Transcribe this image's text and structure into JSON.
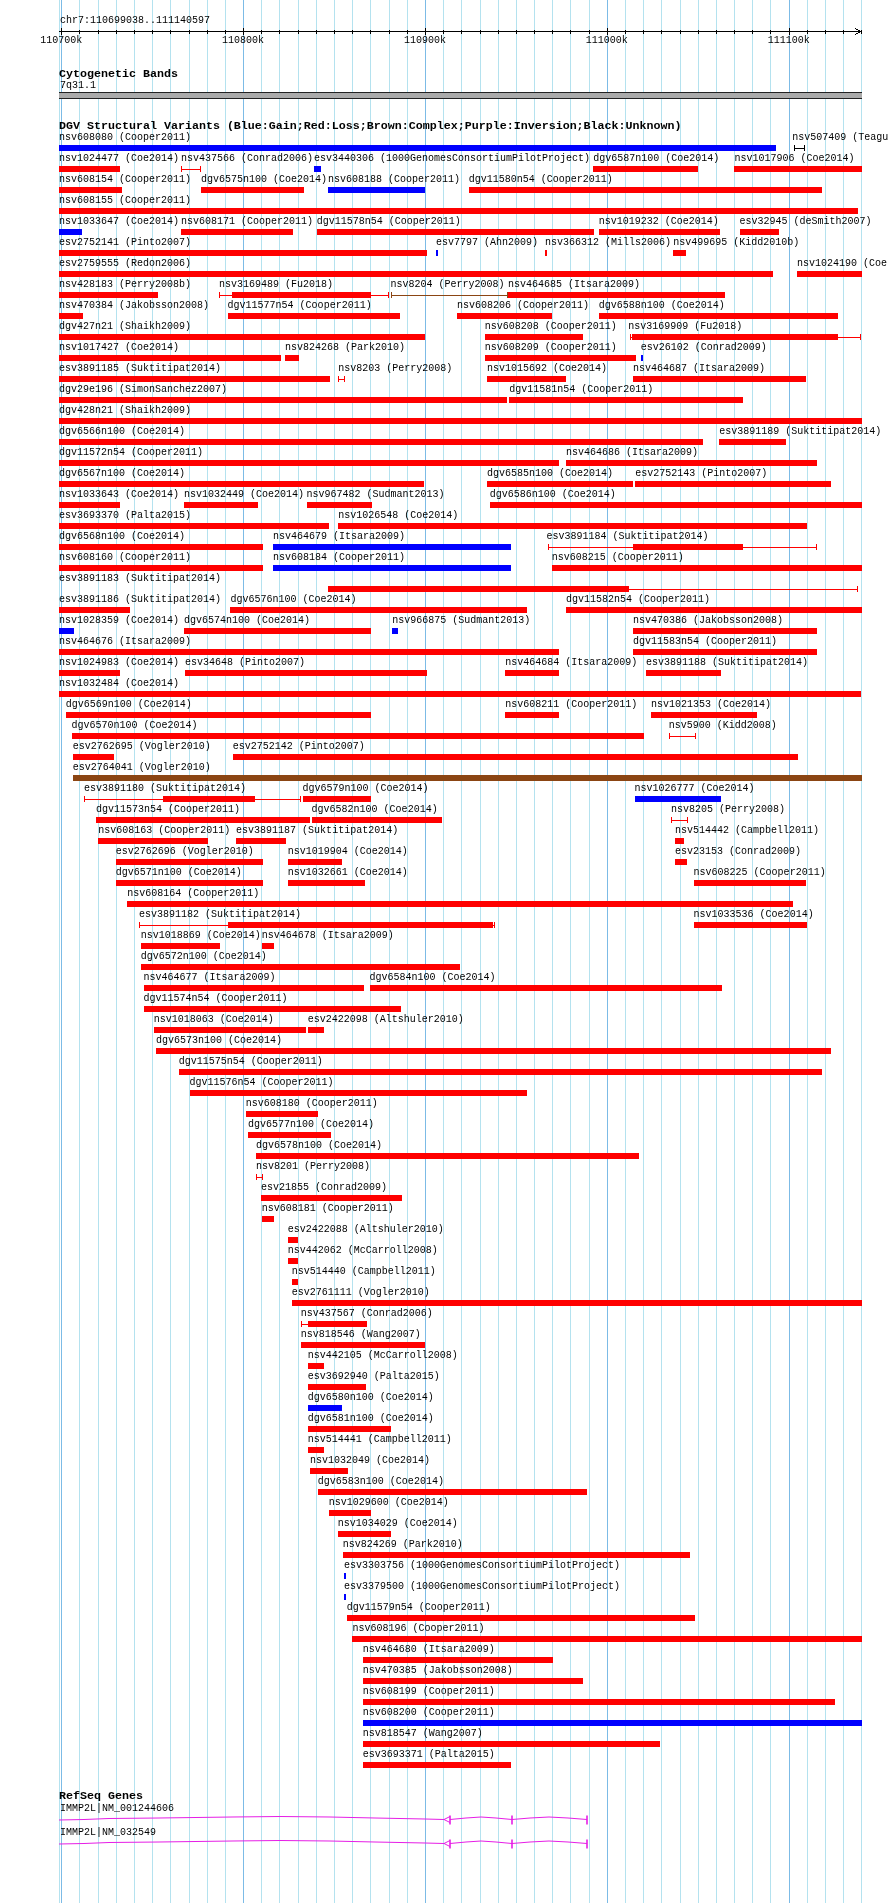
{
  "ruler": {
    "region": "chr7:110699038..111140597",
    "ticks": [
      "110700k",
      "110800k",
      "110900k",
      "111000k",
      "111100k"
    ]
  },
  "cytogenetic_bands": {
    "title": "Cytogenetic Bands",
    "band": "7q31.1"
  },
  "dgv_structural_variants": {
    "title": "DGV Structural Variants (Blue:Gain;Red:Loss;Brown:Complex;Purple:Inversion;Black:Unknown)",
    "rows": [
      {
        "features": [
          {
            "label": "nsv608080 (Cooper2011)",
            "color": "#0000ff"
          },
          {
            "label": "nsv507409 (Teagu",
            "color": "#000000"
          }
        ]
      },
      {
        "features": [
          {
            "label": "nsv1024477 (Coe2014)",
            "color": "#ff0000"
          },
          {
            "label": "nsv437566 (Conrad2006)",
            "color": "#ff0000"
          },
          {
            "label": "esv3440306 (1000GenomesConsortiumPilotProject)",
            "color": "#0000ff"
          },
          {
            "label": "dgv6587n100 (Coe2014)",
            "color": "#ff0000"
          },
          {
            "label": "nsv1017906 (Coe2014)",
            "color": "#ff0000"
          }
        ]
      },
      {
        "features": [
          {
            "label": "nsv608154 (Cooper2011)",
            "color": "#ff0000"
          },
          {
            "label": "dgv6575n100 (Coe2014)",
            "color": "#ff0000"
          },
          {
            "label": "nsv608188 (Cooper2011)",
            "color": "#0000ff"
          },
          {
            "label": "dgv11580n54 (Cooper2011)",
            "color": "#ff0000"
          }
        ]
      },
      {
        "features": [
          {
            "label": "nsv608155 (Cooper2011)",
            "color": "#ff0000"
          }
        ]
      },
      {
        "features": [
          {
            "label": "nsv1033647 (Coe2014)",
            "color": "#0000ff"
          },
          {
            "label": "nsv608171 (Cooper2011)",
            "color": "#ff0000"
          },
          {
            "label": "dgv11578n54 (Cooper2011)",
            "color": "#ff0000"
          },
          {
            "label": "nsv1019232 (Coe2014)",
            "color": "#ff0000"
          },
          {
            "label": "esv32945 (deSmith2007)",
            "color": "#ff0000"
          }
        ]
      },
      {
        "features": [
          {
            "label": "esv2752141 (Pinto2007)",
            "color": "#ff0000"
          },
          {
            "label": "esv7797 (Ahn2009)",
            "color": "#0000ff"
          },
          {
            "label": "nsv366312 (Mills2006)",
            "color": "#ff0000"
          },
          {
            "label": "nsv499695 (Kidd2010b)",
            "color": "#ff0000"
          }
        ]
      },
      {
        "features": [
          {
            "label": "esv2759555 (Redon2006)",
            "color": "#ff0000"
          },
          {
            "label": "nsv1024190 (Coe",
            "color": "#ff0000"
          }
        ]
      },
      {
        "features": [
          {
            "label": "nsv428183 (Perry2008b)",
            "color": "#ff0000"
          },
          {
            "label": "nsv3169489 (Fu2018)",
            "color": "#ff0000"
          },
          {
            "label": "nsv8204 (Perry2008)",
            "color": "#8b4513"
          },
          {
            "label": "nsv464685 (Itsara2009)",
            "color": "#ff0000"
          }
        ]
      },
      {
        "features": [
          {
            "label": "nsv470384 (Jakobsson2008)",
            "color": "#ff0000"
          },
          {
            "label": "dgv11577n54 (Cooper2011)",
            "color": "#ff0000"
          },
          {
            "label": "nsv608206 (Cooper2011)",
            "color": "#ff0000"
          },
          {
            "label": "dgv6588n100 (Coe2014)",
            "color": "#ff0000"
          }
        ]
      },
      {
        "features": [
          {
            "label": "dgv427n21 (Shaikh2009)",
            "color": "#ff0000"
          },
          {
            "label": "nsv608208 (Cooper2011)",
            "color": "#ff0000"
          },
          {
            "label": "nsv3169909 (Fu2018)",
            "color": "#ff0000"
          }
        ]
      },
      {
        "features": [
          {
            "label": "nsv1017427 (Coe2014)",
            "color": "#ff0000"
          },
          {
            "label": "nsv824268 (Park2010)",
            "color": "#ff0000"
          },
          {
            "label": "nsv608209 (Cooper2011)",
            "color": "#ff0000"
          },
          {
            "label": "esv26102 (Conrad2009)",
            "color": "#0000ff"
          }
        ]
      },
      {
        "features": [
          {
            "label": "esv3891185 (Suktitipat2014)",
            "color": "#ff0000"
          },
          {
            "label": "nsv8203 (Perry2008)",
            "color": "#ff0000"
          },
          {
            "label": "nsv1015692 (Coe2014)",
            "color": "#ff0000"
          },
          {
            "label": "nsv464687 (Itsara2009)",
            "color": "#ff0000"
          }
        ]
      },
      {
        "features": [
          {
            "label": "dgv29e196 (SimonSanchez2007)",
            "color": "#ff0000"
          },
          {
            "label": "dgv11581n54 (Cooper2011)",
            "color": "#ff0000"
          }
        ]
      },
      {
        "features": [
          {
            "label": "dgv428n21 (Shaikh2009)",
            "color": "#ff0000"
          }
        ]
      },
      {
        "features": [
          {
            "label": "dgv6566n100 (Coe2014)",
            "color": "#ff0000"
          },
          {
            "label": "esv3891189 (Suktitipat2014)",
            "color": "#ff0000"
          }
        ]
      },
      {
        "features": [
          {
            "label": "dgv11572n54 (Cooper2011)",
            "color": "#ff0000"
          },
          {
            "label": "nsv464686 (Itsara2009)",
            "color": "#ff0000"
          }
        ]
      },
      {
        "features": [
          {
            "label": "dgv6567n100 (Coe2014)",
            "color": "#ff0000"
          },
          {
            "label": "dgv6585n100 (Coe2014)",
            "color": "#ff0000"
          },
          {
            "label": "esv2752143 (Pinto2007)",
            "color": "#ff0000"
          }
        ]
      },
      {
        "features": [
          {
            "label": "nsv1033643 (Coe2014)",
            "color": "#ff0000"
          },
          {
            "label": "nsv1032449 (Coe2014)",
            "color": "#ff0000"
          },
          {
            "label": "nsv967482 (Sudmant2013)",
            "color": "#ff0000"
          },
          {
            "label": "dgv6586n100 (Coe2014)",
            "color": "#ff0000"
          }
        ]
      },
      {
        "features": [
          {
            "label": "esv3693370 (Palta2015)",
            "color": "#ff0000"
          },
          {
            "label": "nsv1026548 (Coe2014)",
            "color": "#ff0000"
          }
        ]
      },
      {
        "features": [
          {
            "label": "dgv6568n100 (Coe2014)",
            "color": "#ff0000"
          },
          {
            "label": "nsv464679 (Itsara2009)",
            "color": "#0000ff"
          },
          {
            "label": "esv3891184 (Suktitipat2014)",
            "color": "#ff0000"
          }
        ]
      },
      {
        "features": [
          {
            "label": "nsv608160 (Cooper2011)",
            "color": "#ff0000"
          },
          {
            "label": "nsv608184 (Cooper2011)",
            "color": "#0000ff"
          },
          {
            "label": "nsv608215 (Cooper2011)",
            "color": "#ff0000"
          }
        ]
      },
      {
        "features": [
          {
            "label": "esv3891183 (Suktitipat2014)",
            "color": "#ff0000"
          }
        ]
      },
      {
        "features": [
          {
            "label": "esv3891186 (Suktitipat2014)",
            "color": "#ff0000"
          },
          {
            "label": "dgv6576n100 (Coe2014)",
            "color": "#ff0000"
          },
          {
            "label": "dgv11582n54 (Cooper2011)",
            "color": "#ff0000"
          }
        ]
      },
      {
        "features": [
          {
            "label": "nsv1028359 (Coe2014)",
            "color": "#0000ff"
          },
          {
            "label": "dgv6574n100 (Coe2014)",
            "color": "#ff0000"
          },
          {
            "label": "nsv966875 (Sudmant2013)",
            "color": "#0000ff"
          },
          {
            "label": "nsv470386 (Jakobsson2008)",
            "color": "#ff0000"
          }
        ]
      },
      {
        "features": [
          {
            "label": "nsv464676 (Itsara2009)",
            "color": "#ff0000"
          },
          {
            "label": "dgv11583n54 (Cooper2011)",
            "color": "#ff0000"
          }
        ]
      },
      {
        "features": [
          {
            "label": "nsv1024983 (Coe2014)",
            "color": "#ff0000"
          },
          {
            "label": "esv34648 (Pinto2007)",
            "color": "#ff0000"
          },
          {
            "label": "nsv464684 (Itsara2009)",
            "color": "#ff0000"
          },
          {
            "label": "esv3891188 (Suktitipat2014)",
            "color": "#ff0000"
          }
        ]
      },
      {
        "features": [
          {
            "label": "nsv1032484 (Coe2014)",
            "color": "#ff0000"
          }
        ]
      },
      {
        "features": [
          {
            "label": "dgv6569n100 (Coe2014)",
            "color": "#ff0000"
          },
          {
            "label": "nsv608211 (Cooper2011)",
            "color": "#ff0000"
          },
          {
            "label": "nsv1021353 (Coe2014)",
            "color": "#ff0000"
          }
        ]
      },
      {
        "features": [
          {
            "label": "dgv6570n100 (Coe2014)",
            "color": "#ff0000"
          },
          {
            "label": "nsv5900 (Kidd2008)",
            "color": "#ff0000"
          }
        ]
      },
      {
        "features": [
          {
            "label": "esv2762695 (Vogler2010)",
            "color": "#ff0000"
          },
          {
            "label": "esv2752142 (Pinto2007)",
            "color": "#ff0000"
          }
        ]
      },
      {
        "features": [
          {
            "label": "esv2764041 (Vogler2010)",
            "color": "#8b4513"
          }
        ]
      },
      {
        "features": [
          {
            "label": "esv3891180 (Suktitipat2014)",
            "color": "#ff0000"
          },
          {
            "label": "dgv6579n100 (Coe2014)",
            "color": "#ff0000"
          },
          {
            "label": "nsv1026777 (Coe2014)",
            "color": "#0000ff"
          }
        ]
      },
      {
        "features": [
          {
            "label": "dgv11573n54 (Cooper2011)",
            "color": "#ff0000"
          },
          {
            "label": "dgv6582n100 (Coe2014)",
            "color": "#ff0000"
          },
          {
            "label": "nsv8205 (Perry2008)",
            "color": "#ff0000"
          }
        ]
      },
      {
        "features": [
          {
            "label": "nsv608163 (Cooper2011)",
            "color": "#ff0000"
          },
          {
            "label": "esv3891187 (Suktitipat2014)",
            "color": "#ff0000"
          },
          {
            "label": "nsv514442 (Campbell2011)",
            "color": "#ff0000"
          }
        ]
      },
      {
        "features": [
          {
            "label": "esv2762696 (Vogler2010)",
            "color": "#ff0000"
          },
          {
            "label": "nsv1019904 (Coe2014)",
            "color": "#ff0000"
          },
          {
            "label": "esv23153 (Conrad2009)",
            "color": "#ff0000"
          }
        ]
      },
      {
        "features": [
          {
            "label": "dgv6571n100 (Coe2014)",
            "color": "#ff0000"
          },
          {
            "label": "nsv1032661 (Coe2014)",
            "color": "#ff0000"
          },
          {
            "label": "nsv608225 (Cooper2011)",
            "color": "#ff0000"
          }
        ]
      },
      {
        "features": [
          {
            "label": "nsv608164 (Cooper2011)",
            "color": "#ff0000"
          }
        ]
      },
      {
        "features": [
          {
            "label": "esv3891182 (Suktitipat2014)",
            "color": "#ff0000"
          },
          {
            "label": "nsv1033536 (Coe2014)",
            "color": "#ff0000"
          }
        ]
      },
      {
        "features": [
          {
            "label": "nsv1018869 (Coe2014)",
            "color": "#ff0000"
          },
          {
            "label": "nsv464678 (Itsara2009)",
            "color": "#ff0000"
          }
        ]
      },
      {
        "features": [
          {
            "label": "dgv6572n100 (Coe2014)",
            "color": "#ff0000"
          }
        ]
      },
      {
        "features": [
          {
            "label": "nsv464677 (Itsara2009)",
            "color": "#ff0000"
          },
          {
            "label": "dgv6584n100 (Coe2014)",
            "color": "#ff0000"
          }
        ]
      },
      {
        "features": [
          {
            "label": "dgv11574n54 (Cooper2011)",
            "color": "#ff0000"
          }
        ]
      },
      {
        "features": [
          {
            "label": "nsv1018063 (Coe2014)",
            "color": "#ff0000"
          },
          {
            "label": "esv2422098 (Altshuler2010)",
            "color": "#ff0000"
          }
        ]
      },
      {
        "features": [
          {
            "label": "dgv6573n100 (Coe2014)",
            "color": "#ff0000"
          }
        ]
      },
      {
        "features": [
          {
            "label": "dgv11575n54 (Cooper2011)",
            "color": "#ff0000"
          }
        ]
      },
      {
        "features": [
          {
            "label": "dgv11576n54 (Cooper2011)",
            "color": "#ff0000"
          }
        ]
      },
      {
        "features": [
          {
            "label": "nsv608180 (Cooper2011)",
            "color": "#ff0000"
          }
        ]
      },
      {
        "features": [
          {
            "label": "dgv6577n100 (Coe2014)",
            "color": "#ff0000"
          }
        ]
      },
      {
        "features": [
          {
            "label": "dgv6578n100 (Coe2014)",
            "color": "#ff0000"
          }
        ]
      },
      {
        "features": [
          {
            "label": "nsv8201 (Perry2008)",
            "color": "#ff0000"
          }
        ]
      },
      {
        "features": [
          {
            "label": "esv21855 (Conrad2009)",
            "color": "#ff0000"
          }
        ]
      },
      {
        "features": [
          {
            "label": "nsv608181 (Cooper2011)",
            "color": "#ff0000"
          }
        ]
      },
      {
        "features": [
          {
            "label": "esv2422088 (Altshuler2010)",
            "color": "#ff0000"
          }
        ]
      },
      {
        "features": [
          {
            "label": "nsv442062 (McCarroll2008)",
            "color": "#ff0000"
          }
        ]
      },
      {
        "features": [
          {
            "label": "nsv514440 (Campbell2011)",
            "color": "#ff0000"
          }
        ]
      },
      {
        "features": [
          {
            "label": "esv2761111 (Vogler2010)",
            "color": "#ff0000"
          }
        ]
      },
      {
        "features": [
          {
            "label": "nsv437567 (Conrad2006)",
            "color": "#ff0000"
          }
        ]
      },
      {
        "features": [
          {
            "label": "nsv818546 (Wang2007)",
            "color": "#ff0000"
          }
        ]
      },
      {
        "features": [
          {
            "label": "nsv442105 (McCarroll2008)",
            "color": "#ff0000"
          }
        ]
      },
      {
        "features": [
          {
            "label": "esv3692940 (Palta2015)",
            "color": "#ff0000"
          }
        ]
      },
      {
        "features": [
          {
            "label": "dgv6580n100 (Coe2014)",
            "color": "#0000ff"
          }
        ]
      },
      {
        "features": [
          {
            "label": "dgv6581n100 (Coe2014)",
            "color": "#ff0000"
          }
        ]
      },
      {
        "features": [
          {
            "label": "nsv514441 (Campbell2011)",
            "color": "#ff0000"
          }
        ]
      },
      {
        "features": [
          {
            "label": "nsv1032049 (Coe2014)",
            "color": "#ff0000"
          }
        ]
      },
      {
        "features": [
          {
            "label": "dgv6583n100 (Coe2014)",
            "color": "#ff0000"
          }
        ]
      },
      {
        "features": [
          {
            "label": "nsv1029600 (Coe2014)",
            "color": "#ff0000"
          }
        ]
      },
      {
        "features": [
          {
            "label": "nsv1034029 (Coe2014)",
            "color": "#ff0000"
          }
        ]
      },
      {
        "features": [
          {
            "label": "nsv824269 (Park2010)",
            "color": "#ff0000"
          }
        ]
      },
      {
        "features": [
          {
            "label": "esv3303756 (1000GenomesConsortiumPilotProject)",
            "color": "#0000ff"
          }
        ]
      },
      {
        "features": [
          {
            "label": "esv3379500 (1000GenomesConsortiumPilotProject)",
            "color": "#0000ff"
          }
        ]
      },
      {
        "features": [
          {
            "label": "dgv11579n54 (Cooper2011)",
            "color": "#ff0000"
          }
        ]
      },
      {
        "features": [
          {
            "label": "nsv608196 (Cooper2011)",
            "color": "#ff0000"
          }
        ]
      },
      {
        "features": [
          {
            "label": "nsv464680 (Itsara2009)",
            "color": "#ff0000"
          }
        ]
      },
      {
        "features": [
          {
            "label": "nsv470385 (Jakobsson2008)",
            "color": "#ff0000"
          }
        ]
      },
      {
        "features": [
          {
            "label": "nsv608199 (Cooper2011)",
            "color": "#ff0000"
          }
        ]
      },
      {
        "features": [
          {
            "label": "nsv608200 (Cooper2011)",
            "color": "#0000ff"
          }
        ]
      },
      {
        "features": [
          {
            "label": "nsv818547 (Wang2007)",
            "color": "#ff0000"
          }
        ]
      },
      {
        "features": [
          {
            "label": "esv3693371 (Palta2015)",
            "color": "#ff0000"
          }
        ]
      }
    ]
  },
  "refseq_genes": {
    "title": "RefSeq Genes",
    "transcripts": [
      {
        "label": "IMMP2L|NM_001244606"
      },
      {
        "label": "IMMP2L|NM_032549"
      }
    ]
  }
}
